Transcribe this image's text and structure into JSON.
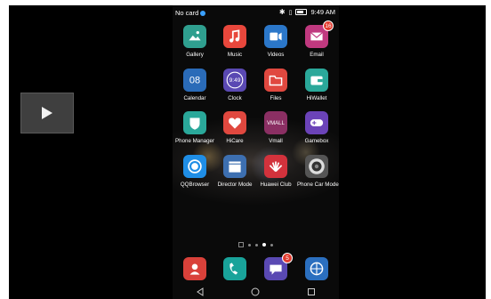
{
  "player": {
    "play_icon": "play-icon"
  },
  "status": {
    "carrier": "No card",
    "time": "9:49 AM",
    "icons": [
      "bluetooth-icon",
      "sim-icon",
      "battery-icon"
    ]
  },
  "apps": [
    {
      "label": "Gallery",
      "color": "#2f9f8f",
      "icon": "image-icon"
    },
    {
      "label": "Music",
      "color": "#e8473c",
      "icon": "music-icon"
    },
    {
      "label": "Videos",
      "color": "#2b77c9",
      "icon": "video-icon"
    },
    {
      "label": "Email",
      "color": "#c0397f",
      "icon": "mail-icon",
      "badge": "16"
    },
    {
      "label": "Calendar",
      "color": "#2a6bb8",
      "icon": "calendar-icon",
      "text": "08"
    },
    {
      "label": "Clock",
      "color": "#5a49b3",
      "icon": "clock-icon",
      "text": "9:49"
    },
    {
      "label": "Files",
      "color": "#e0483f",
      "icon": "folder-icon"
    },
    {
      "label": "HiWallet",
      "color": "#2aa89a",
      "icon": "wallet-icon"
    },
    {
      "label": "Phone Manager",
      "color": "#2aa89a",
      "icon": "shield-icon"
    },
    {
      "label": "HiCare",
      "color": "#e0483f",
      "icon": "heart-icon"
    },
    {
      "label": "Vmall",
      "color": "#8b2f63",
      "icon": "vmall-icon",
      "text": "VMALL"
    },
    {
      "label": "Gamebox",
      "color": "#6b43b8",
      "icon": "gamepad-icon"
    },
    {
      "label": "QQBrowser",
      "color": "#1f8ee6",
      "icon": "browser-icon"
    },
    {
      "label": "Director Mode",
      "color": "#3d6fb0",
      "icon": "clapper-icon"
    },
    {
      "label": "Huawei Club",
      "color": "#d3323c",
      "icon": "huawei-icon"
    },
    {
      "label": "Phone Car Mode",
      "color": "#555555",
      "icon": "speaker-icon"
    }
  ],
  "dock": [
    {
      "name": "contacts",
      "color": "#d9413a",
      "icon": "contacts-icon"
    },
    {
      "name": "phone",
      "color": "#19a39a",
      "icon": "phone-icon"
    },
    {
      "name": "messaging",
      "color": "#5a49b3",
      "icon": "message-icon",
      "badge": "5"
    },
    {
      "name": "browser",
      "color": "#2b6fbf",
      "icon": "globe-icon"
    }
  ],
  "pager": {
    "count": 4,
    "active": 2
  },
  "navbar": [
    "back-icon",
    "home-icon",
    "recents-icon"
  ]
}
